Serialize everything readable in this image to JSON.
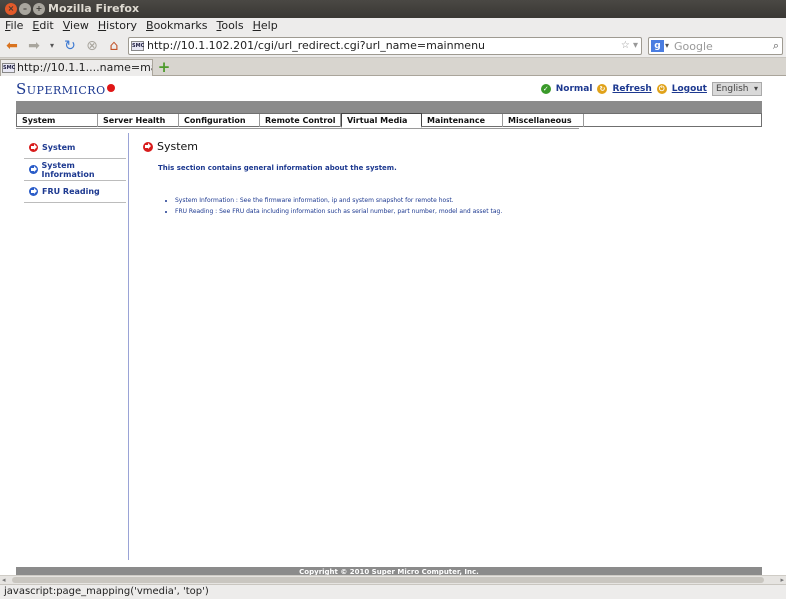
{
  "window": {
    "title": "Mozilla Firefox"
  },
  "menubar": [
    "File",
    "Edit",
    "View",
    "History",
    "Bookmarks",
    "Tools",
    "Help"
  ],
  "navbar": {
    "url": "http://10.1.102.201/cgi/url_redirect.cgi?url_name=mainmenu",
    "search_placeholder": "Google",
    "favicon_text": "SMC"
  },
  "tab": {
    "label": "http://10.1.1....name=mainmenu"
  },
  "page": {
    "logo": "Supermicro",
    "status": "Normal",
    "refresh": "Refresh",
    "logout": "Logout",
    "language": "English",
    "nav": [
      "System",
      "Server Health",
      "Configuration",
      "Remote Control",
      "Virtual Media",
      "Maintenance",
      "Miscellaneous"
    ],
    "active_nav": "Virtual Media",
    "sidebar": [
      "System",
      "System Information",
      "FRU Reading"
    ],
    "main_title": "System",
    "main_desc": "This section contains general information about the system.",
    "bullets": [
      "System Information : See the firmware information, ip and system snapshot for remote host.",
      "FRU Reading : See FRU data including information such as serial number, part number, model and asset tag."
    ],
    "footer": "Copyright © 2010 Super Micro Computer, Inc."
  },
  "statusbar": {
    "text": "javascript:page_mapping('vmedia', 'top')"
  },
  "colors": {
    "brand_blue": "#1d3990",
    "accent_red": "#d81c1c",
    "band_gray": "#8b8b8b"
  }
}
